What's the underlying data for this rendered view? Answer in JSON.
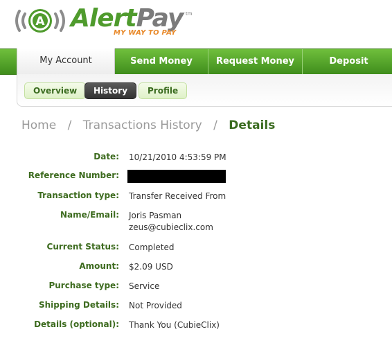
{
  "logo": {
    "name_part1": "Alert",
    "name_part2": "Pay",
    "tm": "tm",
    "tagline": "MY WAY TO PAY",
    "mark_letter": "A"
  },
  "nav": {
    "tabs": [
      {
        "label": "My Account",
        "active": true
      },
      {
        "label": "Send Money",
        "active": false
      },
      {
        "label": "Request Money",
        "active": false
      },
      {
        "label": "Deposit",
        "active": false
      }
    ]
  },
  "subnav": {
    "tabs": [
      {
        "label": "Overview",
        "active": false
      },
      {
        "label": "History",
        "active": true
      },
      {
        "label": "Profile",
        "active": false
      }
    ]
  },
  "breadcrumb": {
    "home": "Home",
    "sep": "/",
    "section": "Transactions History",
    "current": "Details"
  },
  "details": [
    {
      "label": "Date:",
      "value": "10/21/2010 4:53:59 PM"
    },
    {
      "label": "Reference Number:",
      "value": "",
      "redacted": true
    },
    {
      "label": "Transaction type:",
      "value": "Transfer Received From"
    },
    {
      "label": "Name/Email:",
      "value": "Joris Pasman",
      "value2": "zeus@cubieclix.com"
    },
    {
      "label": "Current Status:",
      "value": "Completed"
    },
    {
      "label": "Amount:",
      "value": "$2.09 USD"
    },
    {
      "label": "Purchase type:",
      "value": "Service"
    },
    {
      "label": "Shipping Details:",
      "value": "Not Provided"
    },
    {
      "label": "Details (optional):",
      "value": "Thank You (CubieClix)"
    }
  ],
  "colors": {
    "brand_green": "#4f9b2d",
    "label_green": "#3d6b1f",
    "tagline_orange": "#e8892a",
    "logo_gray": "#7b7b7b"
  }
}
